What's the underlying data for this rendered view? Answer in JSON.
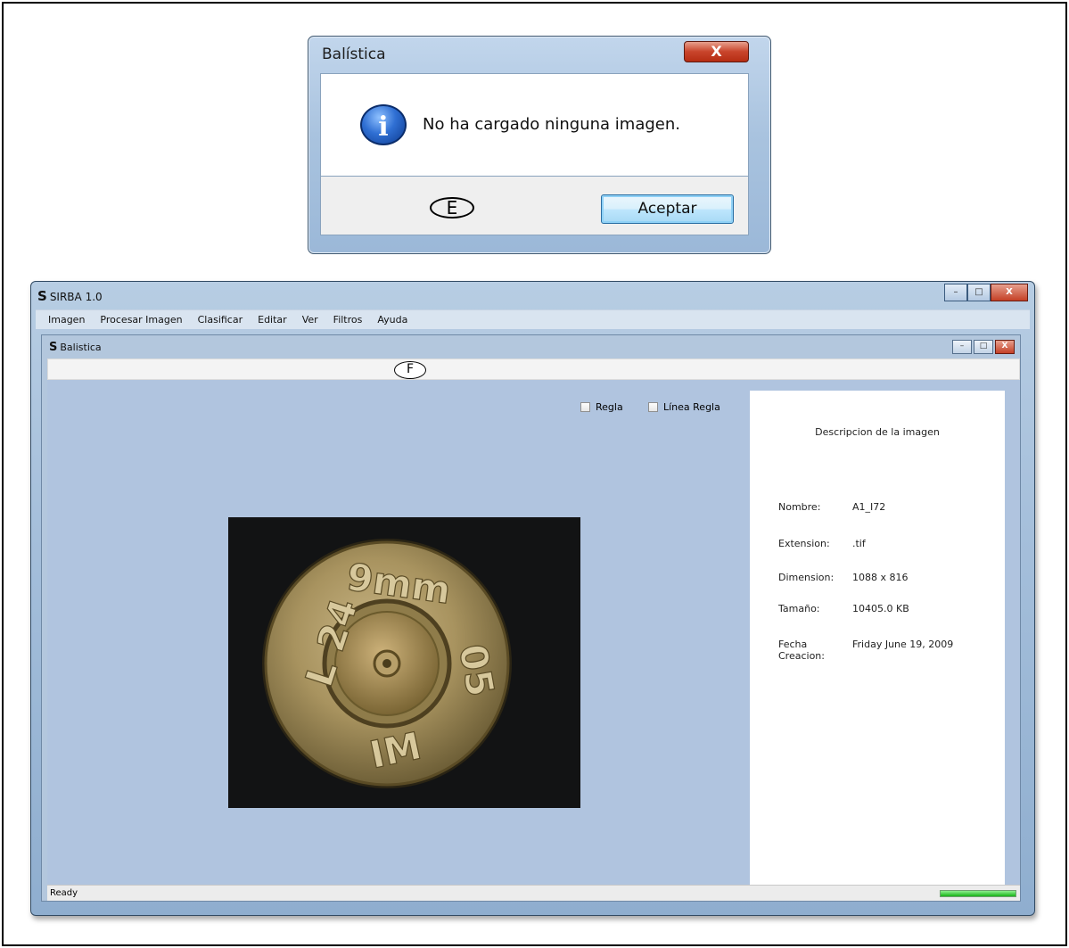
{
  "dialog": {
    "title": "Balística",
    "close_label": "X",
    "message": "No ha cargado ninguna imagen.",
    "ok_label": "Aceptar",
    "callout": "E"
  },
  "app": {
    "title": "SIRBA 1.0",
    "logo": "S",
    "window_buttons": [
      "–",
      "□",
      "X"
    ],
    "menu": [
      "Imagen",
      "Procesar Imagen",
      "Clasificar",
      "Editar",
      "Ver",
      "Filtros",
      "Ayuda"
    ]
  },
  "child": {
    "title": "Balistica",
    "logo": "S",
    "callout": "F",
    "window_buttons": [
      "–",
      "□",
      "X"
    ]
  },
  "checkboxes": [
    {
      "label": "Regla",
      "checked": false
    },
    {
      "label": "Línea Regla",
      "checked": false
    }
  ],
  "image_description": {
    "heading": "Descripcion de la imagen",
    "fields": [
      {
        "label": "Nombre:",
        "value": "A1_I72"
      },
      {
        "label": "Extension:",
        "value": ".tif"
      },
      {
        "label": "Dimension:",
        "value": "1088 x 816"
      },
      {
        "label": "Tamaño:",
        "value": "10405.0 KB"
      },
      {
        "label": "Fecha Creacion:",
        "value": "Friday June 19, 2009"
      }
    ]
  },
  "coin_stamp": {
    "top": "9mm",
    "left": "L 24",
    "right": "05",
    "bottom": "IM"
  },
  "status": {
    "text": "Ready",
    "progress": 1.0
  },
  "colors": {
    "workarea": "#b0c4df",
    "progress": "#17b317"
  }
}
